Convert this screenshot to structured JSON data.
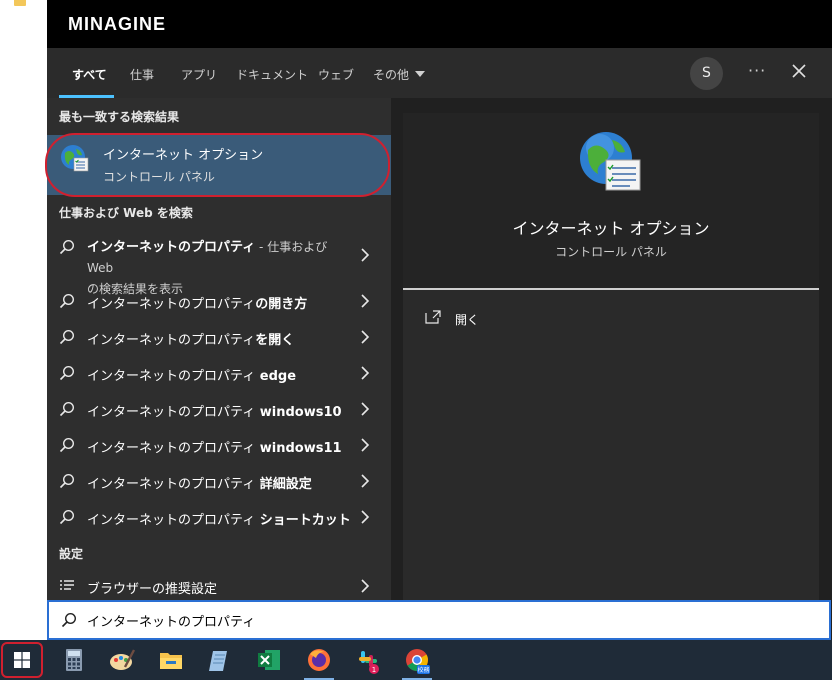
{
  "brand": "MINAGINE",
  "tabs": [
    {
      "label": "すべて",
      "active": true
    },
    {
      "label": "仕事",
      "active": false
    },
    {
      "label": "アプリ",
      "active": false
    },
    {
      "label": "ドキュメント",
      "active": false
    },
    {
      "label": "ウェブ",
      "active": false
    },
    {
      "label": "その他",
      "active": false
    }
  ],
  "account_initial": "S",
  "more_options": "···",
  "best_match": {
    "heading": "最も一致する検索結果",
    "title": "インターネット オプション",
    "subtitle": "コントロール パネル"
  },
  "web_search": {
    "heading": "仕事および Web を検索",
    "first": {
      "main": "インターネットのプロパティ",
      "suffix": " - 仕事および Web",
      "line2": "の検索結果を表示"
    },
    "items": [
      {
        "plain": "インターネットのプロパティ",
        "bold": "の開き方"
      },
      {
        "plain": "インターネットのプロパティ",
        "bold": "を開く"
      },
      {
        "plain": "インターネットのプロパティ",
        "bold": " edge"
      },
      {
        "plain": "インターネットのプロパティ",
        "bold": " windows10"
      },
      {
        "plain": "インターネットのプロパティ",
        "bold": " windows11"
      },
      {
        "plain": "インターネットのプロパティ",
        "bold": " 詳細設定"
      },
      {
        "plain": "インターネットのプロパティ",
        "bold": " ショートカット"
      }
    ]
  },
  "settings": {
    "heading": "設定",
    "item": "ブラウザーの推奨設定"
  },
  "preview": {
    "title": "インターネット オプション",
    "subtitle": "コントロール パネル",
    "action_open": "開く"
  },
  "search": {
    "value": "インターネットのプロパティ"
  },
  "taskbar": {
    "apps": [
      "calculator-icon",
      "paint-icon",
      "file-explorer-icon",
      "notepad-icon",
      "excel-icon",
      "firefox-icon",
      "slack-icon",
      "chrome-icon"
    ],
    "slack_badge": "1",
    "chrome_badge": "校務"
  },
  "colors": {
    "accent": "#4cc2ff",
    "selection": "#3a5b79",
    "highlight_outline": "#d0202f",
    "taskbar": "#1f2b38"
  }
}
